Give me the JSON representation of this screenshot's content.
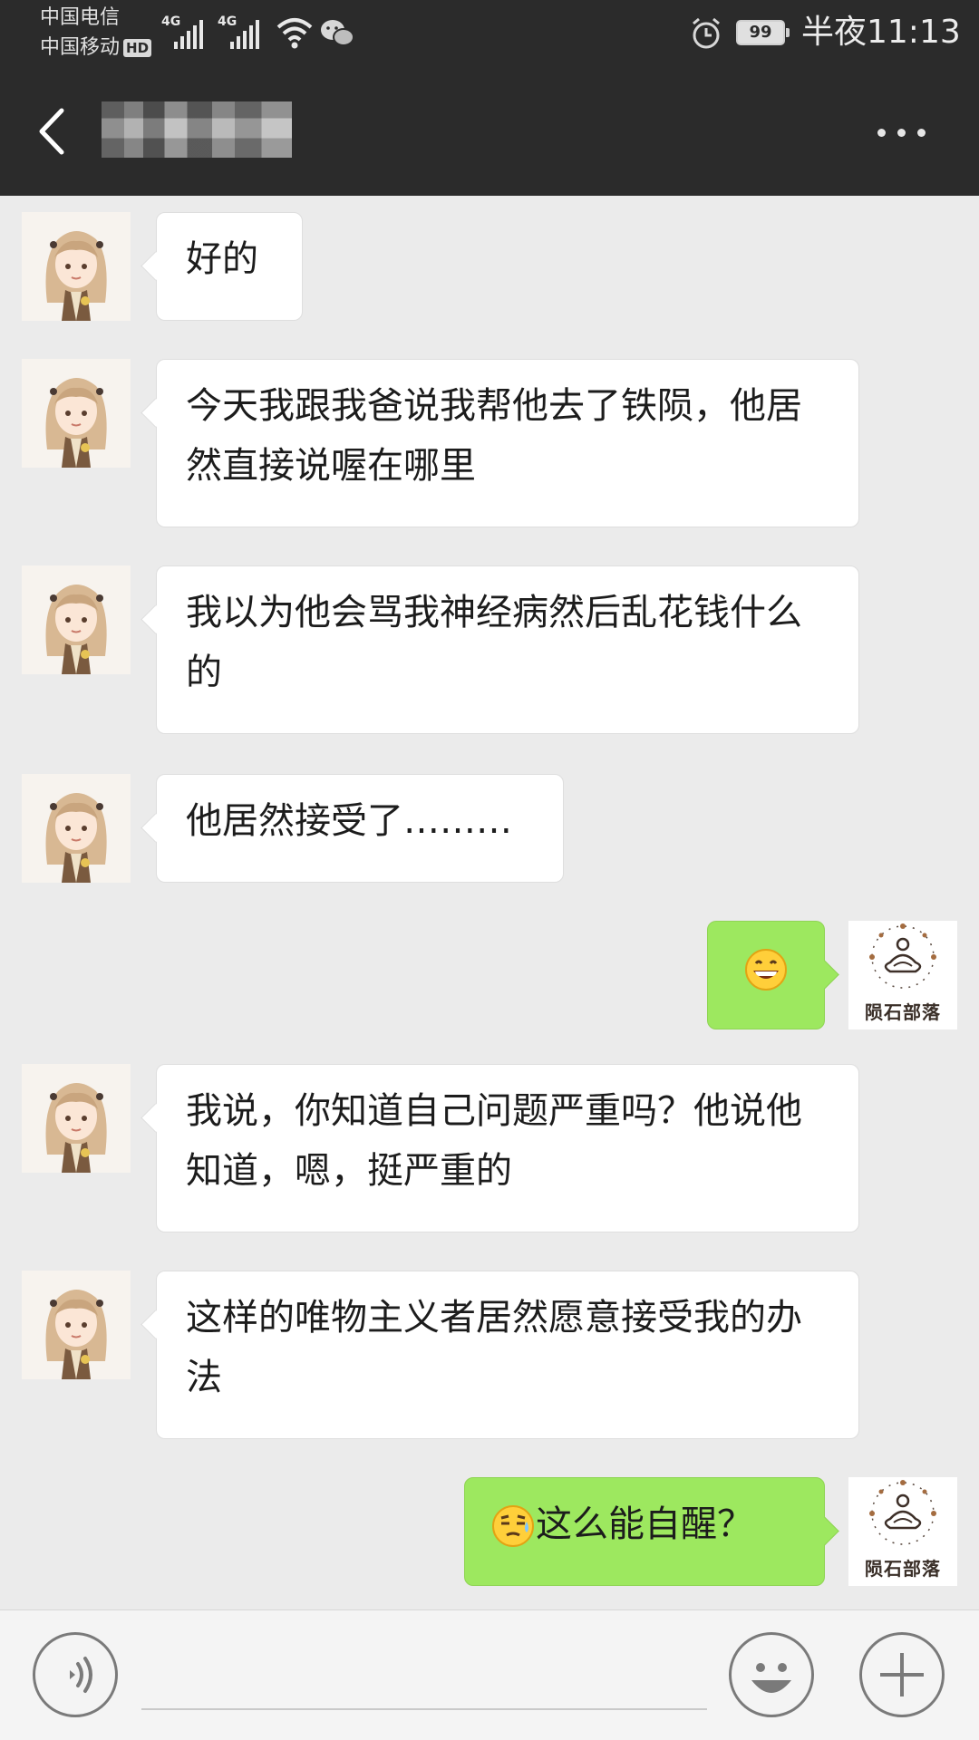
{
  "status_bar": {
    "carrier_1": "中国电信",
    "carrier_2": "中国移动",
    "hd_badge": "HD",
    "network_1": "4G",
    "network_2": "4G",
    "battery": "99",
    "time": "半夜11:13"
  },
  "header": {
    "contact_name": "",
    "back_icon": "chevron-left-icon",
    "more_icon": "more-horizontal-icon"
  },
  "messages": [
    {
      "side": "left",
      "text": "好的"
    },
    {
      "side": "left",
      "text": "今天我跟我爸说我帮他去了铁陨，他居然直接说喔在哪里"
    },
    {
      "side": "left",
      "text": "我以为他会骂我神经病然后乱花钱什么的"
    },
    {
      "side": "left",
      "text": "他居然接受了………"
    },
    {
      "side": "right",
      "emoji": "grinning-face",
      "text": ""
    },
    {
      "side": "left",
      "text": "我说，你知道自己问题严重吗？他说他知道，嗯，挺严重的"
    },
    {
      "side": "left",
      "text": "这样的唯物主义者居然愿意接受我的办法"
    },
    {
      "side": "right",
      "emoji": "sweat-face",
      "text": "这么能自醒？"
    }
  ],
  "self_avatar": {
    "logo_text": "陨石部落"
  },
  "input_bar": {
    "voice_icon": "voice-icon",
    "emoji_icon": "emoji-icon",
    "add_icon": "plus-icon",
    "message_value": ""
  },
  "colors": {
    "header_bg": "#2b2b2b",
    "chat_bg": "#ebebeb",
    "own_bubble": "#9de85f",
    "other_bubble": "#ffffff"
  }
}
